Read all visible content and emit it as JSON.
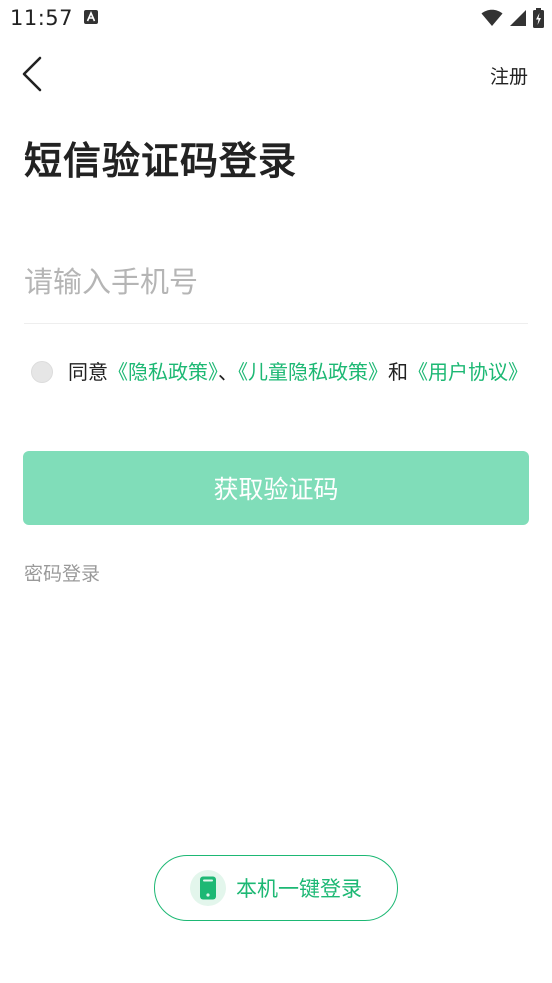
{
  "status_bar": {
    "time": "11:57"
  },
  "nav": {
    "register_label": "注册"
  },
  "page": {
    "title": "短信验证码登录"
  },
  "phone_field": {
    "placeholder": "请输入手机号",
    "value": ""
  },
  "agreement": {
    "checked": false,
    "prefix": "同意",
    "privacy_policy": "《隐私政策》",
    "separator": "、",
    "children_privacy_policy": "《儿童隐私政策》",
    "conjunction": "和",
    "user_agreement": "《用户协议》"
  },
  "actions": {
    "get_code_label": "获取验证码",
    "password_login_label": "密码登录",
    "one_key_login_label": "本机一键登录"
  },
  "colors": {
    "accent": "#1db874",
    "button_disabled": "#80ddb9",
    "placeholder": "#b5b5b5"
  },
  "icons": {
    "back": "chevron-left-icon",
    "wifi": "wifi-icon",
    "signal": "signal-icon",
    "battery": "battery-charging-icon",
    "app_notification": "app-notification-icon",
    "phone": "phone-icon"
  }
}
